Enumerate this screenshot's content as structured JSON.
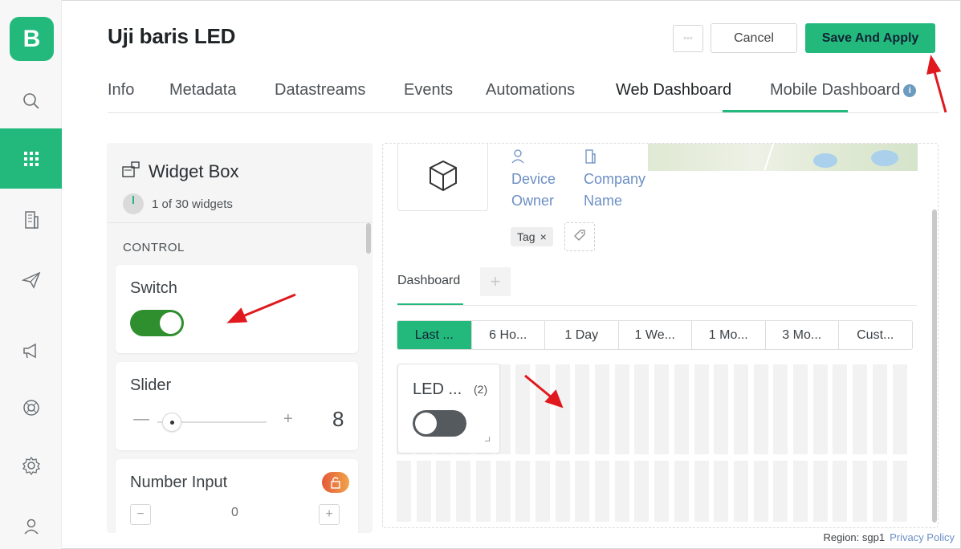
{
  "app": {
    "logo_letter": "B"
  },
  "header": {
    "title": "Uji baris LED",
    "more_label": "◦◦◦",
    "cancel_label": "Cancel",
    "save_label": "Save And Apply"
  },
  "tabs": [
    "Info",
    "Metadata",
    "Datastreams",
    "Events",
    "Automations",
    "Web Dashboard",
    "Mobile Dashboard"
  ],
  "active_tab": "Web Dashboard",
  "widget_box": {
    "title": "Widget Box",
    "count": "1 of 30 widgets",
    "section": "CONTROL",
    "widgets": {
      "switch": "Switch",
      "slider": "Slider",
      "slider_minus": "—",
      "slider_plus": "+",
      "slider_value": "8",
      "number_input": "Number Input",
      "ni_minus": "−",
      "ni_plus": "+",
      "ni_value": "0"
    }
  },
  "device": {
    "owner_label_1": "Device",
    "owner_label_2": "Owner",
    "company_label_1": "Company",
    "company_label_2": "Name",
    "tag": "Tag",
    "tag_remove": "×"
  },
  "dashboard": {
    "tab": "Dashboard",
    "add_tab": "+",
    "ranges": [
      "Last ...",
      "6 Ho...",
      "1 Day",
      "1 We...",
      "1 Mo...",
      "3 Mo...",
      "Cust..."
    ],
    "led_widget": {
      "label": "LED ...",
      "count": "(2)"
    }
  },
  "footer": {
    "region": "Region: sgp1",
    "privacy": "Privacy Policy"
  },
  "colors": {
    "accent": "#23b97d",
    "link": "#6c8fc4",
    "annotation": "#e0191e"
  }
}
